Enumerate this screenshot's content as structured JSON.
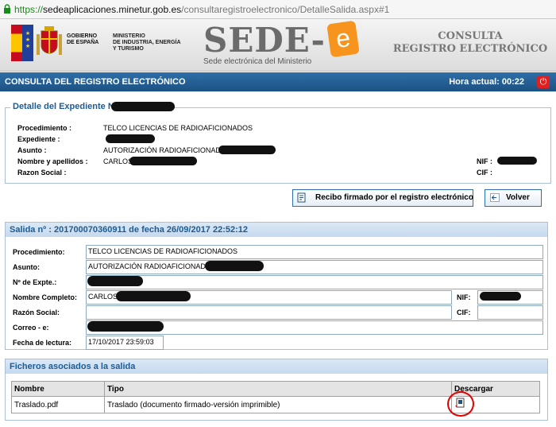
{
  "browser": {
    "url_scheme": "https://",
    "url_host": "sedeaplicaciones.minetur.gob.es",
    "url_path": "/consultaregistroelectronico/DetalleSalida.aspx#1"
  },
  "header": {
    "gov_line1": "GOBIERNO",
    "gov_line2": "DE ESPAÑA",
    "ministry_line1": "MINISTERIO",
    "ministry_line2": "DE INDUSTRIA, ENERGÍA",
    "ministry_line3": "Y TURISMO",
    "sede_word": "SEDE-",
    "sede_e": "e",
    "sede_subtitle": "Sede electrónica del Ministerio",
    "consulta_line1": "CONSULTA",
    "consulta_line2": "REGISTRO ELECTRÓNICO"
  },
  "titlebar": {
    "title": "CONSULTA DEL REGISTRO ELECTRÓNICO",
    "hora": "Hora actual: 00:22"
  },
  "detalle": {
    "legend": "Detalle del Expediente Nº",
    "procedimiento_label": "Procedimiento :",
    "procedimiento_value": "TELCO LICENCIAS DE RADIOAFICIONADOS",
    "expediente_label": "Expediente :",
    "asunto_label": "Asunto :",
    "asunto_value": "AUTORIZACIÓN RADIOAFICIONADO -",
    "nombre_label": "Nombre y apellidos :",
    "nombre_value": "CARLOS",
    "razon_label": "Razon Social :",
    "nif_label": "NIF :",
    "cif_label": "CIF :"
  },
  "buttons": {
    "recibo": "Recibo firmado por el registro electrónico",
    "volver": "Volver"
  },
  "salida": {
    "header": "Salida nº : 201700070360911 de fecha 26/09/2017 22:52:12",
    "procedimiento_label": "Procedimiento:",
    "procedimiento_value": "TELCO LICENCIAS DE RADIOAFICIONADOS",
    "asunto_label": "Asunto:",
    "asunto_value": "AUTORIZACIÓN RADIOAFICIONADO -",
    "expte_label": "Nº de Expte.:",
    "nombre_label": "Nombre Completo:",
    "nombre_value": "CARLOS",
    "nif_label": "NIF:",
    "razon_label": "Razón Social:",
    "cif_label": "CIF:",
    "correo_label": "Correo - e:",
    "fecha_label": "Fecha de lectura:",
    "fecha_value": "17/10/2017 23:59:03"
  },
  "ficheros": {
    "header": "Ficheros asociados a la salida",
    "columns": [
      "Nombre",
      "Tipo",
      "Descargar"
    ],
    "rows": [
      {
        "nombre": "Traslado.pdf",
        "tipo": "Traslado (documento firmado-versión imprimible)"
      }
    ]
  },
  "colors": {
    "titlebar": "#1d5183",
    "section_text": "#1d5b93",
    "highlight_ring": "#e00000",
    "sede_orange": "#f7941d"
  },
  "icons": [
    "lock-icon",
    "power-icon",
    "receipt-icon",
    "back-icon",
    "download-icon"
  ]
}
